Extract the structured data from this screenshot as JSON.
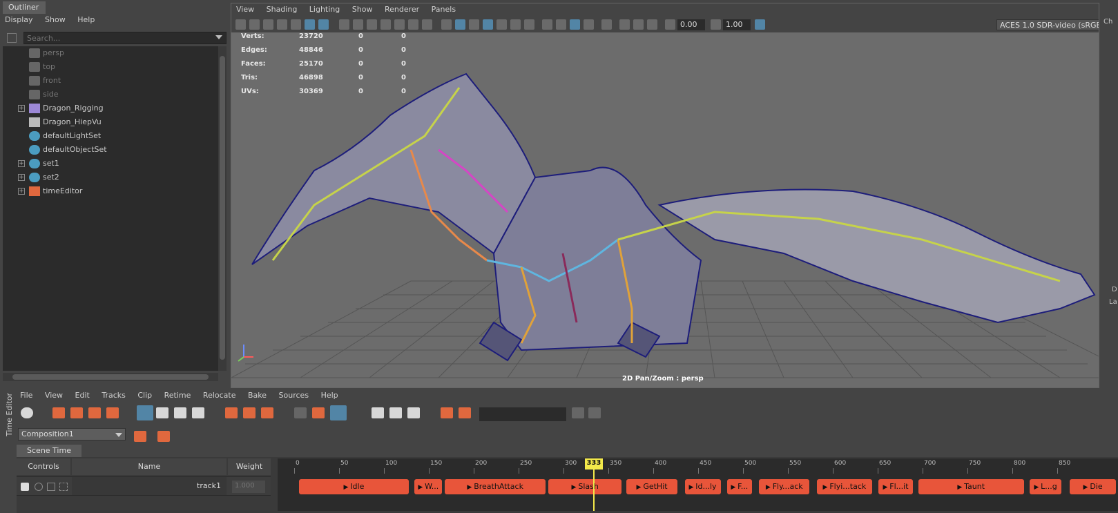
{
  "outliner": {
    "title": "Outliner",
    "menu": [
      "Display",
      "Show",
      "Help"
    ],
    "search_placeholder": "Search...",
    "items": [
      {
        "label": "persp",
        "kind": "camera"
      },
      {
        "label": "top",
        "kind": "camera"
      },
      {
        "label": "front",
        "kind": "camera"
      },
      {
        "label": "side",
        "kind": "camera"
      },
      {
        "label": "Dragon_Rigging",
        "kind": "joint",
        "expandable": true
      },
      {
        "label": "Dragon_HiepVu",
        "kind": "mesh"
      },
      {
        "label": "defaultLightSet",
        "kind": "set"
      },
      {
        "label": "defaultObjectSet",
        "kind": "set"
      },
      {
        "label": "set1",
        "kind": "set",
        "expandable": true
      },
      {
        "label": "set2",
        "kind": "set",
        "expandable": true
      },
      {
        "label": "timeEditor",
        "kind": "time-editor",
        "expandable": true
      }
    ]
  },
  "viewport": {
    "menu": [
      "View",
      "Shading",
      "Lighting",
      "Show",
      "Renderer",
      "Panels"
    ],
    "exposure": "0.00",
    "gamma": "1.00",
    "color_space": "ACES 1.0 SDR-video (sRGB)",
    "stats": [
      {
        "label": "Verts:",
        "v1": "23720",
        "v2": "0",
        "v3": "0"
      },
      {
        "label": "Edges:",
        "v1": "48846",
        "v2": "0",
        "v3": "0"
      },
      {
        "label": "Faces:",
        "v1": "25170",
        "v2": "0",
        "v3": "0"
      },
      {
        "label": "Tris:",
        "v1": "46898",
        "v2": "0",
        "v3": "0"
      },
      {
        "label": "UVs:",
        "v1": "30369",
        "v2": "0",
        "v3": "0"
      }
    ],
    "hud": "2D Pan/Zoom : persp",
    "right_edge_labels": [
      "Ch",
      "D",
      "La"
    ]
  },
  "time_editor": {
    "side_label": "Time Editor",
    "menu": [
      "File",
      "View",
      "Edit",
      "Tracks",
      "Clip",
      "Retime",
      "Relocate",
      "Bake",
      "Sources",
      "Help"
    ],
    "composition": "Composition1",
    "scene_time_tab": "Scene Time",
    "headers": {
      "controls": "Controls",
      "name": "Name",
      "weight": "Weight"
    },
    "track": {
      "name": "track1",
      "weight": "1.000"
    },
    "ticks": [
      "0",
      "50",
      "100",
      "150",
      "200",
      "250",
      "300",
      "350",
      "400",
      "450",
      "500",
      "550",
      "600",
      "650",
      "700",
      "750",
      "800",
      "850"
    ],
    "current_frame": "333",
    "clips": [
      {
        "label": "Idle",
        "start": 5,
        "end": 128
      },
      {
        "label": "W...",
        "start": 134,
        "end": 165
      },
      {
        "label": "BreathAttack",
        "start": 168,
        "end": 280
      },
      {
        "label": "Slash",
        "start": 283,
        "end": 365
      },
      {
        "label": "GetHit",
        "start": 370,
        "end": 427
      },
      {
        "label": "Id...ly",
        "start": 435,
        "end": 475
      },
      {
        "label": "F...",
        "start": 482,
        "end": 510
      },
      {
        "label": "Fly...ack",
        "start": 518,
        "end": 574
      },
      {
        "label": "Flyi...tack",
        "start": 582,
        "end": 644
      },
      {
        "label": "Fl...it",
        "start": 651,
        "end": 689
      },
      {
        "label": "Taunt",
        "start": 695,
        "end": 813
      },
      {
        "label": "L...g",
        "start": 819,
        "end": 855
      },
      {
        "label": "Die",
        "start": 864,
        "end": 960
      }
    ]
  },
  "colors": {
    "accent": "#5285a6",
    "clip": "#e8553a",
    "playhead": "#f3e94a"
  }
}
